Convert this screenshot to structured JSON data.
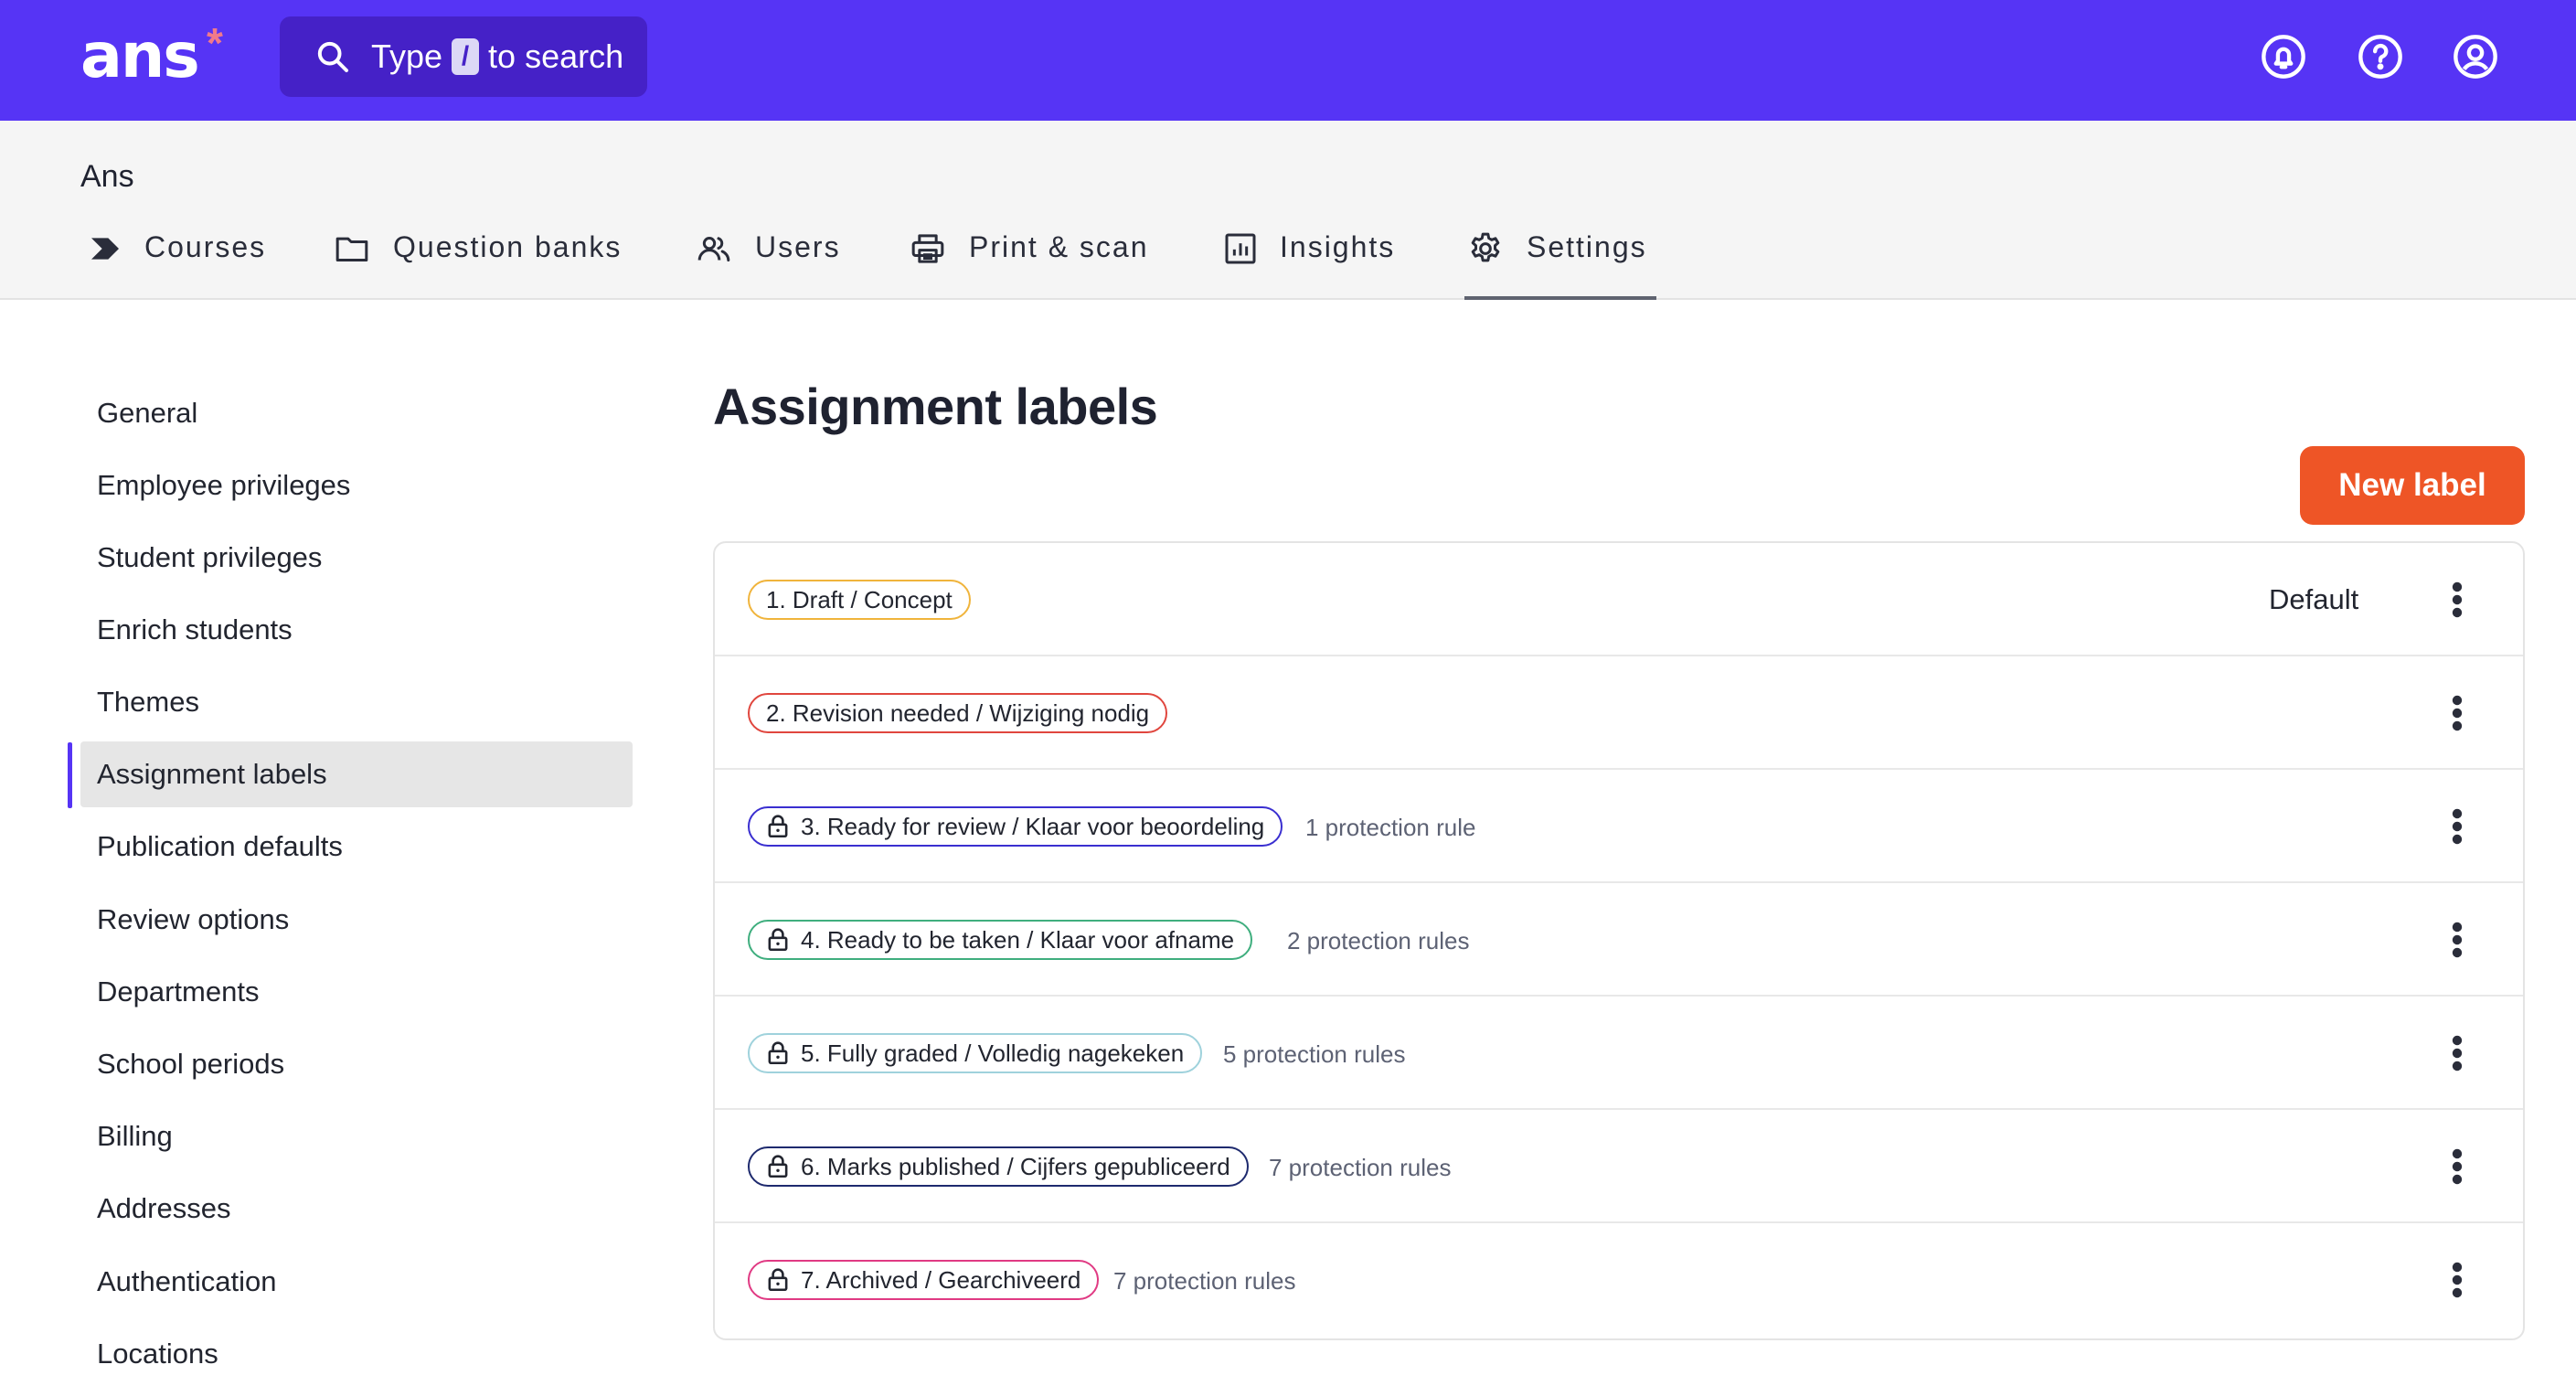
{
  "app": {
    "logo": "ans",
    "logo_mark": "*",
    "search": {
      "prefix": "Type",
      "key": "/",
      "suffix": "to search"
    },
    "header_icons": [
      "bell-icon",
      "help-icon",
      "account-icon"
    ]
  },
  "org_name": "Ans",
  "nav": [
    {
      "label": "Courses",
      "icon": "courses-chevron-icon"
    },
    {
      "label": "Question banks",
      "icon": "folder-icon"
    },
    {
      "label": "Users",
      "icon": "users-icon"
    },
    {
      "label": "Print & scan",
      "icon": "printer-icon"
    },
    {
      "label": "Insights",
      "icon": "chart-icon"
    },
    {
      "label": "Settings",
      "icon": "gear-icon",
      "active": true
    }
  ],
  "sidebar": [
    {
      "label": "General"
    },
    {
      "label": "Employee privileges"
    },
    {
      "label": "Student privileges"
    },
    {
      "label": "Enrich students"
    },
    {
      "label": "Themes"
    },
    {
      "label": "Assignment labels",
      "active": true
    },
    {
      "label": "Publication defaults"
    },
    {
      "label": "Review options"
    },
    {
      "label": "Departments"
    },
    {
      "label": "School periods"
    },
    {
      "label": "Billing"
    },
    {
      "label": "Addresses"
    },
    {
      "label": "Authentication"
    },
    {
      "label": "Locations"
    }
  ],
  "main": {
    "title": "Assignment labels",
    "new_button": "New label",
    "labels": [
      {
        "name": "1. Draft / Concept",
        "color": "#f0b43c",
        "locked": false,
        "rules": "",
        "default": "Default"
      },
      {
        "name": "2. Revision needed / Wijziging nodig",
        "color": "#e0463e",
        "locked": false,
        "rules": "",
        "default": ""
      },
      {
        "name": "3. Ready for review / Klaar voor beoordeling",
        "color": "#3a2fd0",
        "locked": true,
        "rules": "1 protection rule",
        "default": ""
      },
      {
        "name": "4. Ready to be taken / Klaar voor afname",
        "color": "#3fae7e",
        "locked": true,
        "rules": "2 protection rules",
        "default": ""
      },
      {
        "name": "5. Fully graded / Volledig nagekeken",
        "color": "#9fd2dc",
        "locked": true,
        "rules": "5 protection rules",
        "default": ""
      },
      {
        "name": "6. Marks published / Cijfers gepubliceerd",
        "color": "#1e2a6e",
        "locked": true,
        "rules": "7 protection rules",
        "default": ""
      },
      {
        "name": "7. Archived / Gearchiveerd",
        "color": "#e03a83",
        "locked": true,
        "rules": "7 protection rules",
        "default": ""
      }
    ]
  }
}
